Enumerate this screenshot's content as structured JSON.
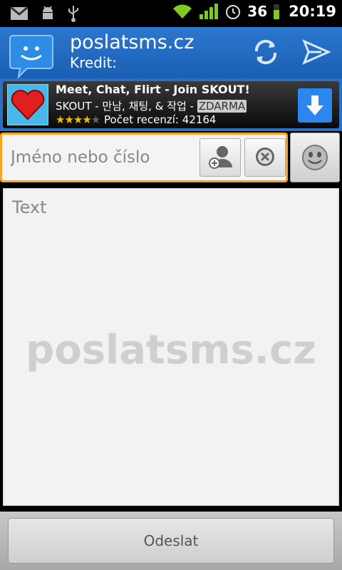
{
  "status_bar": {
    "battery_level": "36",
    "time": "20:19",
    "icons": [
      "gmail-icon",
      "android-debug-icon",
      "usb-icon",
      "wifi-icon",
      "signal-icon",
      "alarm-icon",
      "battery-icon"
    ]
  },
  "header": {
    "title": "poslatsms.cz",
    "credit_label": "Kredit:",
    "icons": [
      "app-logo-icon",
      "refresh-icon",
      "send-icon"
    ],
    "accent_color": "#1f6bc4"
  },
  "ad": {
    "title": "Meet, Chat, Flirt - Join SKOUT!",
    "subtitle": "SKOUT - 만남, 채팅, & 작업 -",
    "badge": "ZDARMA",
    "stars_filled": "★★★★",
    "stars_empty": "★",
    "reviews": "Počet recenzí: 42164",
    "rating_value": 4,
    "rating_max": 5
  },
  "form": {
    "recipient_placeholder": "Jméno nebo číslo",
    "text_placeholder": "Text",
    "watermark": "poslatsms.cz",
    "highlight_color": "#ffa31a"
  },
  "bottom": {
    "send_label": "Odeslat"
  }
}
